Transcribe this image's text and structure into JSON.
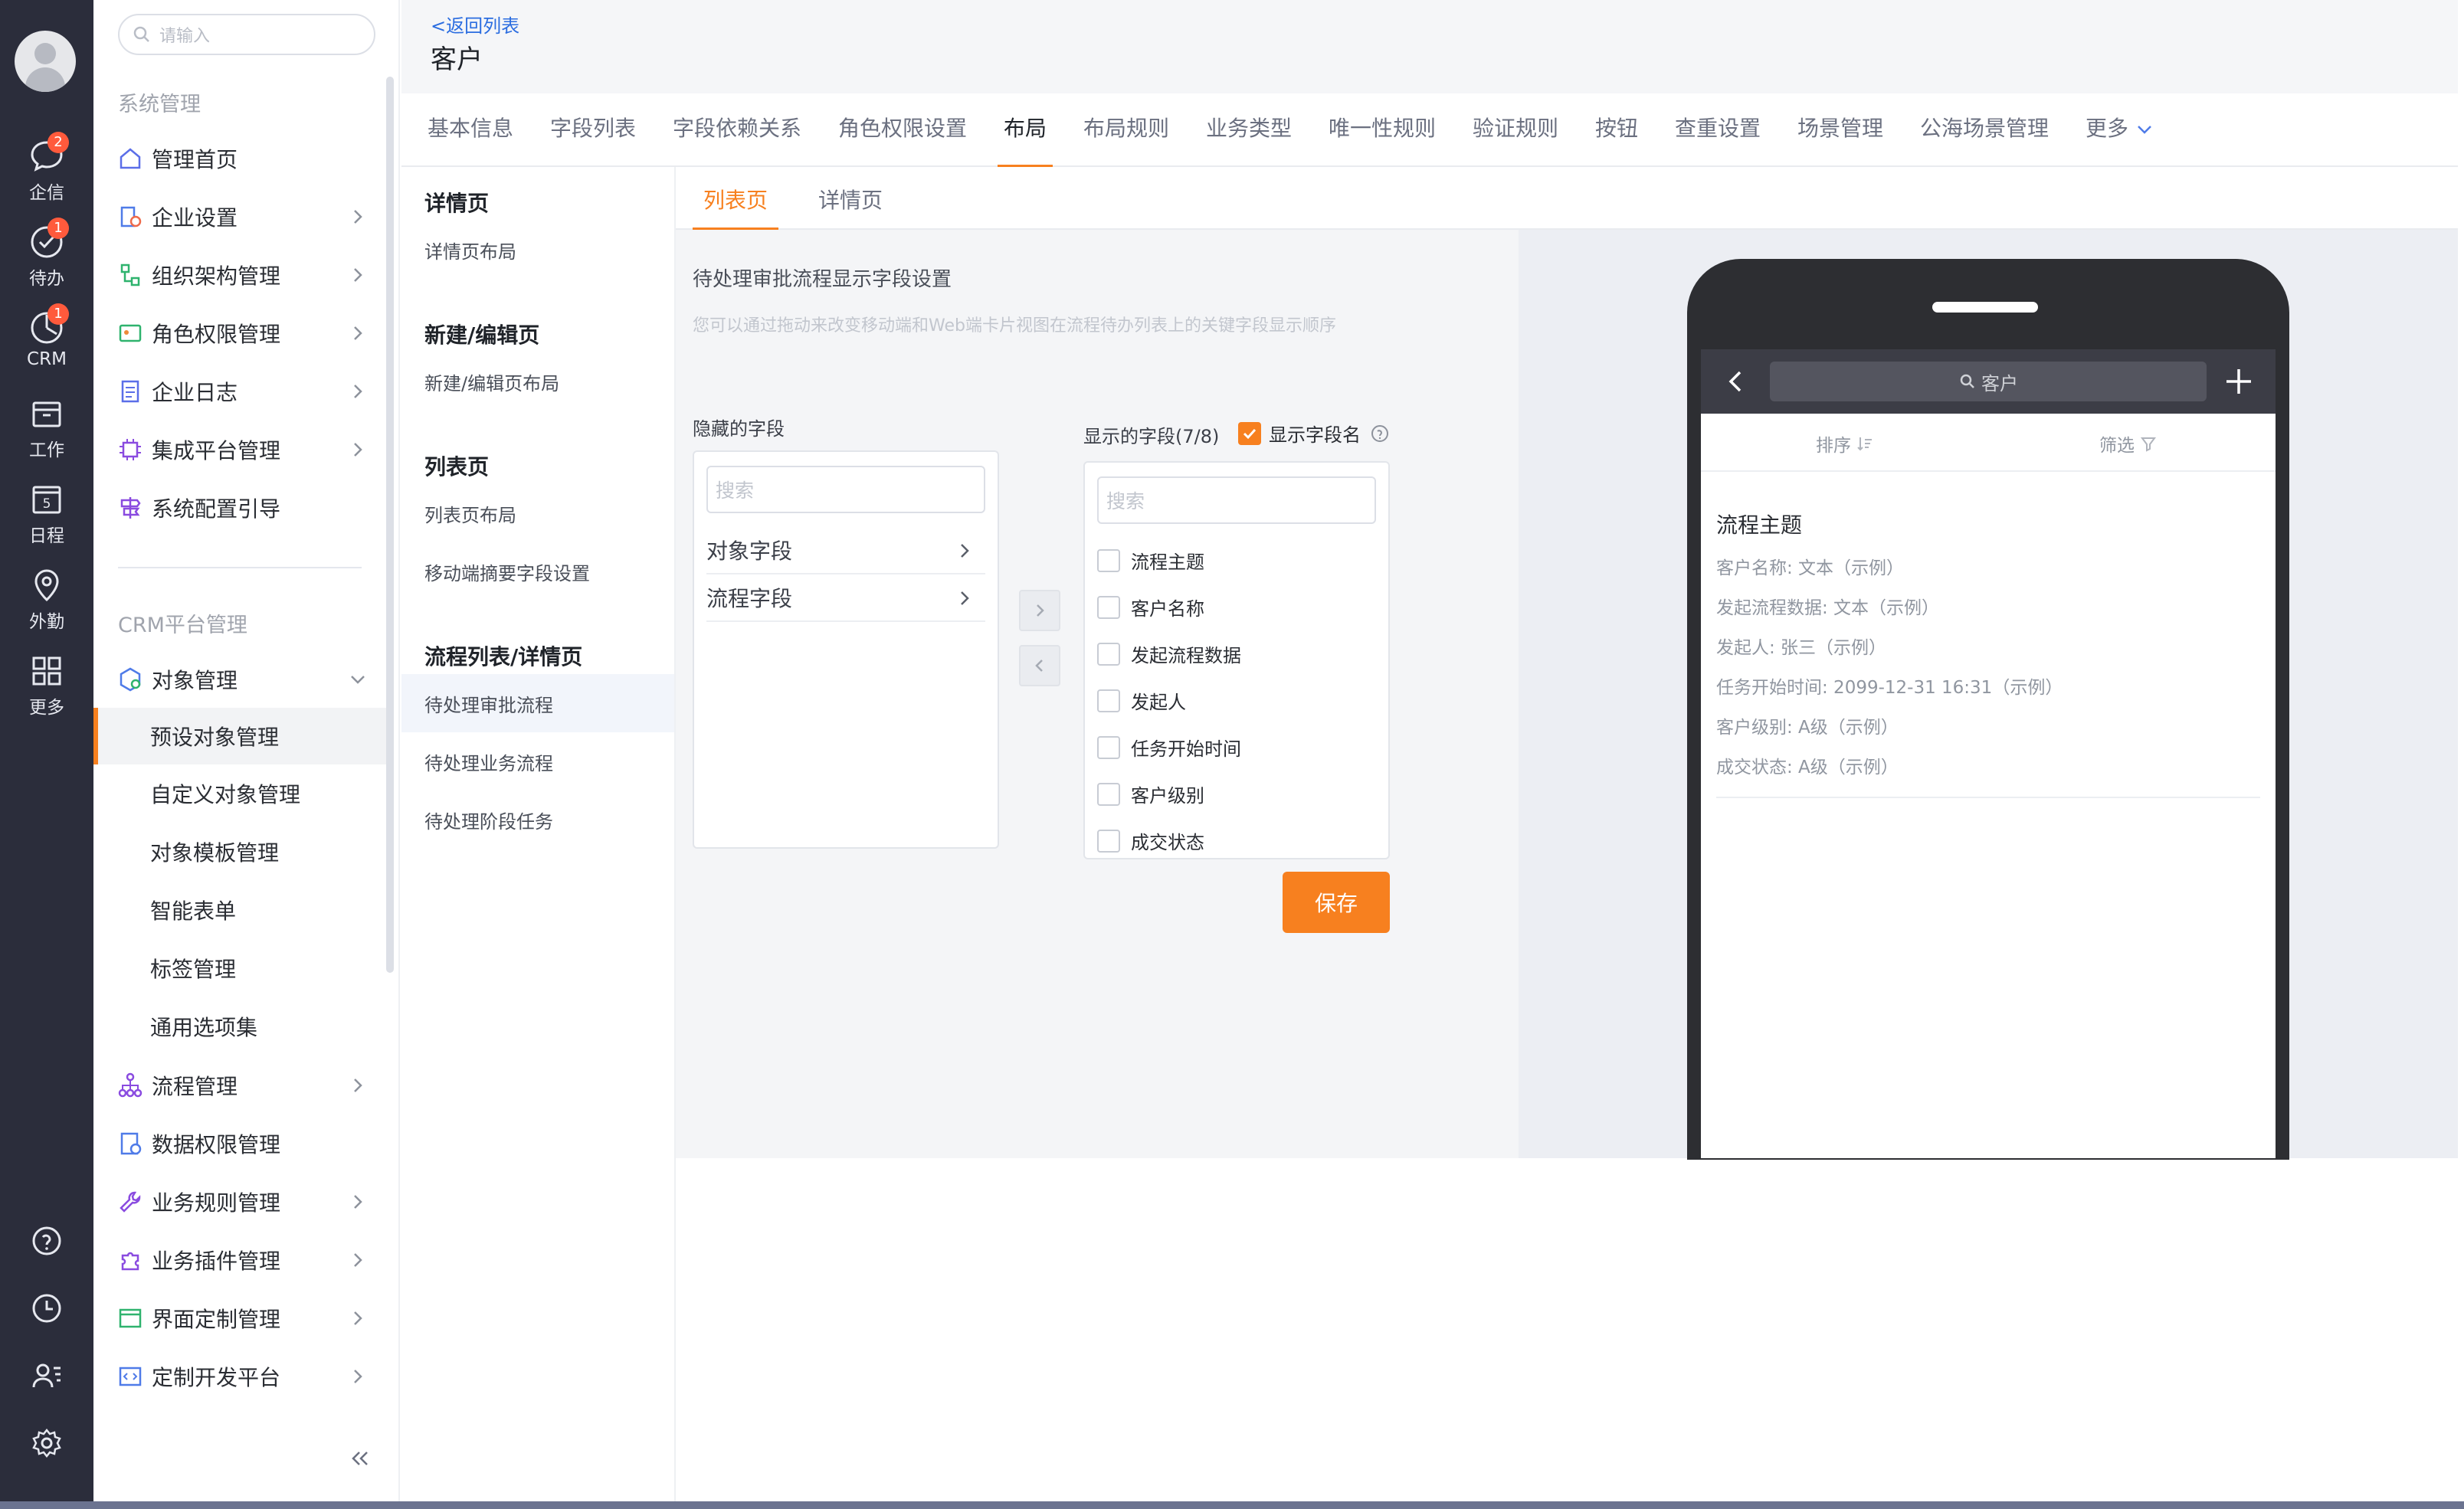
{
  "rail": {
    "items": [
      {
        "label": "企信",
        "badge": "2"
      },
      {
        "label": "待办",
        "badge": "1"
      },
      {
        "label": "CRM",
        "badge": "1"
      },
      {
        "label": "工作"
      },
      {
        "label": "日程",
        "icon_text": "5"
      },
      {
        "label": "外勤"
      },
      {
        "label": "更多"
      }
    ]
  },
  "menu": {
    "search_placeholder": "请输入",
    "group1_title": "系统管理",
    "group1_items": [
      "管理首页",
      "企业设置",
      "组织架构管理",
      "角色权限管理",
      "企业日志",
      "集成平台管理",
      "系统配置引导"
    ],
    "group2_title": "CRM平台管理",
    "object_mgmt": "对象管理",
    "object_sub": [
      "预设对象管理",
      "自定义对象管理",
      "对象模板管理",
      "智能表单",
      "标签管理",
      "通用选项集"
    ],
    "active_sub": "预设对象管理",
    "group2_items": [
      "流程管理",
      "数据权限管理",
      "业务规则管理",
      "业务插件管理",
      "界面定制管理",
      "定制开发平台"
    ]
  },
  "header": {
    "back_link": "<返回列表",
    "title": "客户"
  },
  "tabs": [
    "基本信息",
    "字段列表",
    "字段依赖关系",
    "角色权限设置",
    "布局",
    "布局规则",
    "业务类型",
    "唯一性规则",
    "验证规则",
    "按钮",
    "查重设置",
    "场景管理",
    "公海场景管理",
    "更多"
  ],
  "active_tab": "布局",
  "categories": {
    "detail_title": "详情页",
    "detail_items": [
      "详情页布局"
    ],
    "edit_title": "新建/编辑页",
    "edit_items": [
      "新建/编辑页布局"
    ],
    "list_title": "列表页",
    "list_items": [
      "列表页布局",
      "移动端摘要字段设置"
    ],
    "flow_title": "流程列表/详情页",
    "flow_items": [
      "待处理审批流程",
      "待处理业务流程",
      "待处理阶段任务"
    ],
    "active_item": "待处理审批流程"
  },
  "subtabs": [
    "列表页",
    "详情页"
  ],
  "active_subtab": "列表页",
  "config": {
    "title": "待处理审批流程显示字段设置",
    "desc": "您可以通过拖动来改变移动端和Web端卡片视图在流程待办列表上的关键字段显示顺序",
    "hidden_label": "隐藏的字段",
    "shown_label": "显示的字段(7/8)",
    "show_field_name": "显示字段名",
    "search_placeholder": "搜索",
    "hidden_groups": [
      "对象字段",
      "流程字段"
    ],
    "shown_fields": [
      "流程主题",
      "客户名称",
      "发起流程数据",
      "发起人",
      "任务开始时间",
      "客户级别",
      "成交状态"
    ],
    "save_label": "保存"
  },
  "phone": {
    "search_text": "客户",
    "sort_label": "排序",
    "filter_label": "筛选",
    "card_title": "流程主题",
    "card_lines": [
      "客户名称: 文本（示例）",
      "发起流程数据: 文本（示例）",
      "发起人: 张三（示例）",
      "任务开始时间: 2099-12-31 16:31（示例）",
      "客户级别: A级（示例）",
      "成交状态: A级（示例）"
    ]
  },
  "colors": {
    "accent": "#f7801f",
    "rail_bg": "#2b2d3b",
    "badge": "#ff5a3c",
    "link": "#2b6de0"
  }
}
